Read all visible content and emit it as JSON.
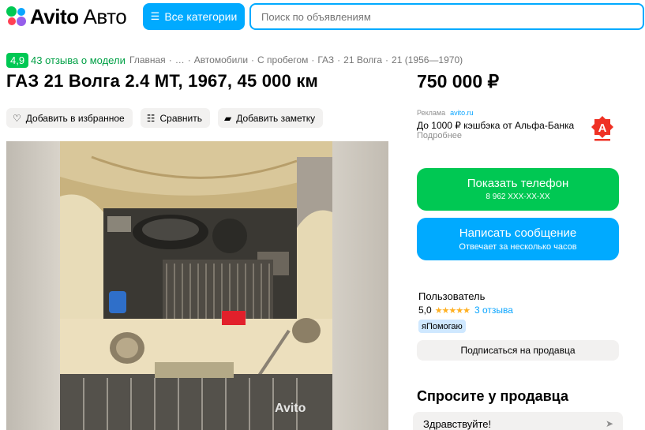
{
  "header": {
    "logo_brand": "Avito",
    "logo_suffix": "Авто",
    "categories_label": "Все категории",
    "search_placeholder": "Поиск по объявлениям"
  },
  "model_rating": {
    "score": "4,9",
    "reviews": "43 отзыва о модели"
  },
  "breadcrumbs": [
    "Главная",
    "…",
    "Автомобили",
    "С пробегом",
    "ГАЗ",
    "21 Волга",
    "21 (1956—1970)"
  ],
  "listing": {
    "title": "ГАЗ 21 Волга 2.4 MT, 1967, 45 000 км",
    "price": "750 000 ₽"
  },
  "actions": {
    "favorite": "Добавить в избранное",
    "compare": "Сравнить",
    "note": "Добавить заметку"
  },
  "ad": {
    "label": "Реклама",
    "source": "avito.ru",
    "text": "До 1000 ₽ кэшбэка от Альфа-Банка",
    "more": "Подробнее",
    "logo_letter": "А"
  },
  "photo": {
    "watermark": "Avito"
  },
  "contact": {
    "phone_label": "Показать телефон",
    "phone_number": "8 962 XXX-XX-XX",
    "message_label": "Написать сообщение",
    "message_sub": "Отвечает за несколько часов"
  },
  "seller": {
    "name": "Пользователь",
    "rating": "5,0",
    "stars": "★★★★★",
    "reviews": "3 отзыва",
    "badge": "яПомогаю",
    "subscribe": "Подписаться на продавца"
  },
  "ask": {
    "title": "Спросите у продавца",
    "message": "Здравствуйте!"
  },
  "colors": {
    "green": "#00c853",
    "blue": "#00aaff",
    "red": "#ef3124"
  }
}
